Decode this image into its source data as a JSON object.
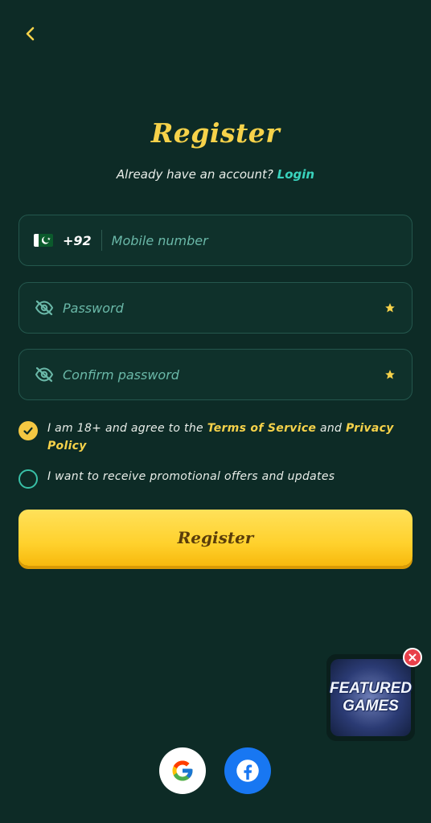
{
  "header": {
    "title": "Register",
    "already_text": "Already have an account?",
    "login_label": "Login"
  },
  "form": {
    "phone": {
      "country_code": "+92",
      "placeholder": "Mobile number",
      "value": ""
    },
    "password": {
      "placeholder": "Password",
      "value": ""
    },
    "confirm_password": {
      "placeholder": "Confirm password",
      "value": ""
    }
  },
  "agreements": {
    "terms": {
      "checked": true,
      "prefix": "I am 18+ and agree to the",
      "terms_label": "Terms of Service",
      "and": "and",
      "privacy_label": "Privacy Policy"
    },
    "promo": {
      "checked": false,
      "label": "I want to receive promotional offers and updates"
    }
  },
  "register_button": {
    "label": "Register"
  },
  "featured": {
    "line1": "FEATURED",
    "line2": "GAMES"
  },
  "social": [
    {
      "name": "google",
      "icon": "google-icon"
    },
    {
      "name": "facebook",
      "icon": "facebook-icon"
    }
  ],
  "colors": {
    "background": "#0d2b26",
    "accent_yellow": "#f6d24a",
    "accent_teal": "#39d3bd",
    "field_border": "#24574d"
  }
}
